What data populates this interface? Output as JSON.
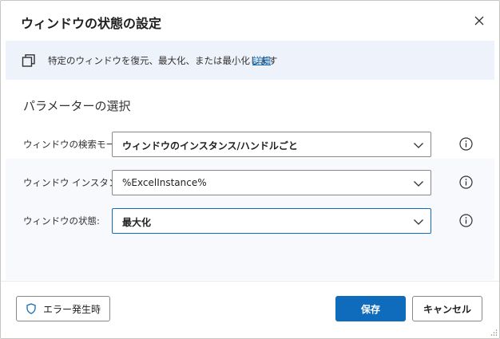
{
  "dialog": {
    "title": "ウィンドウの状態の設定",
    "close_icon": "close-icon"
  },
  "banner": {
    "icon": "restore-window-icon",
    "text": "特定のウィンドウを復元、最大化、または最小化します",
    "link": "詳細"
  },
  "section": {
    "title": "パラメーターの選択"
  },
  "fields": [
    {
      "label": "ウィンドウの検索モード:",
      "value": "ウィンドウのインスタンス/ハンドルごと"
    },
    {
      "label": "ウィンドウ インスタンス:",
      "value": "%ExcelInstance%"
    },
    {
      "label": "ウィンドウの状態:",
      "value": "最大化"
    }
  ],
  "footer": {
    "error_button": "エラー発生時",
    "save_button": "保存",
    "cancel_button": "キャンセル"
  },
  "colors": {
    "accent": "#0f6cbd",
    "banner_bg": "#eef2fb"
  }
}
